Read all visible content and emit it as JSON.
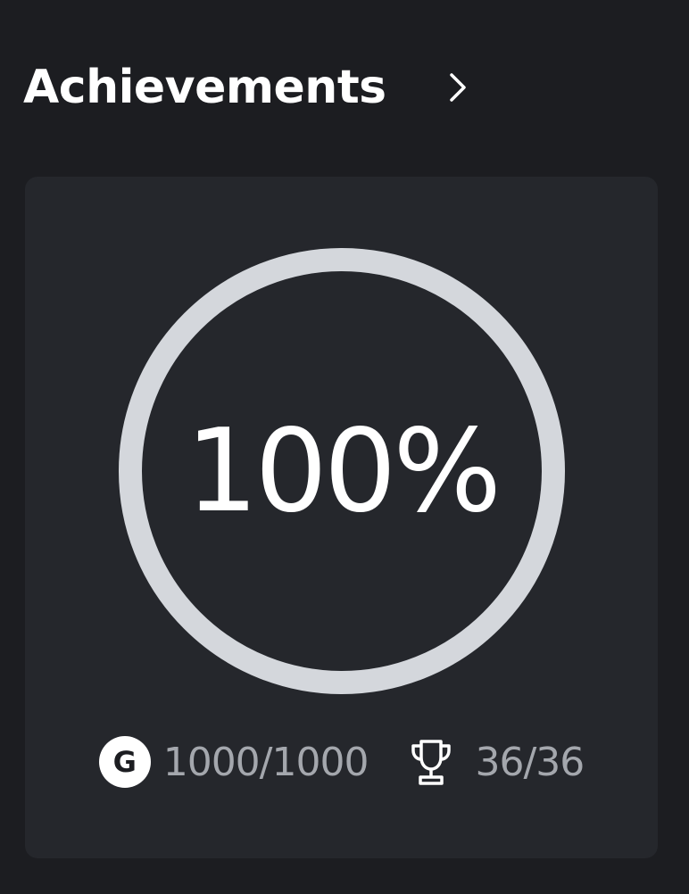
{
  "header": {
    "title": "Achievements",
    "chevron_icon": "chevron-right-icon"
  },
  "summary": {
    "percent_label": "100%",
    "progress_fraction": 1.0,
    "ring_color": "#d4d7dc",
    "gamerscore": {
      "icon": "gamerscore-icon",
      "badge_letter": "G",
      "value": "1000/1000"
    },
    "achievements": {
      "icon": "trophy-icon",
      "value": "36/36"
    }
  }
}
